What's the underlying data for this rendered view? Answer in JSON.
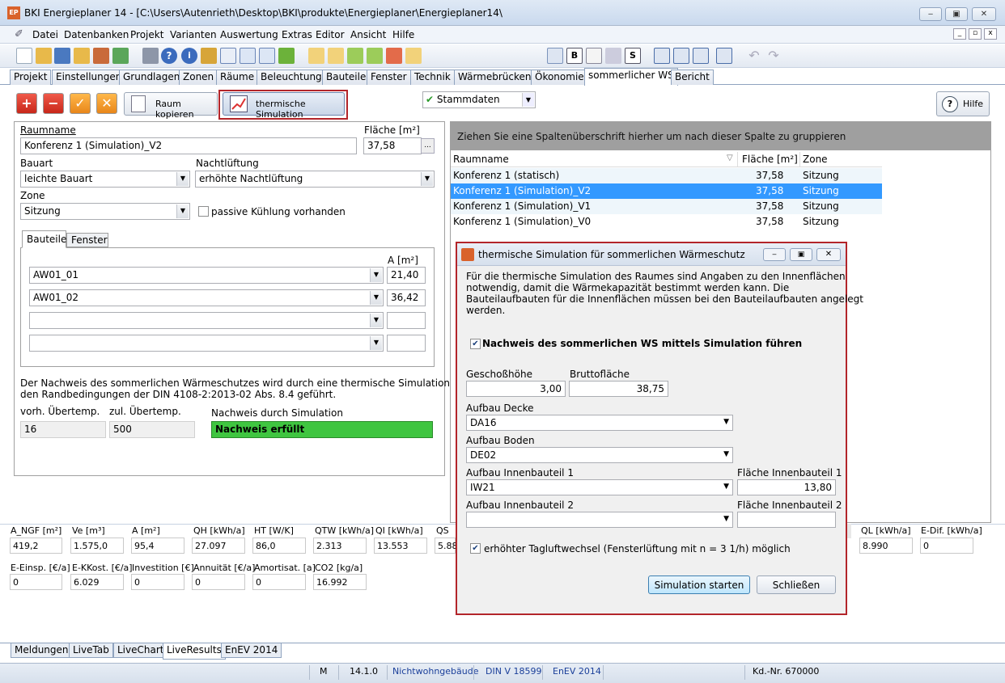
{
  "window": {
    "title": "BKI Energieplaner 14 - [C:\\Users\\Autenrieth\\Desktop\\BKI\\produkte\\Energieplaner\\Energieplaner14\\"
  },
  "menu": [
    "Datei",
    "Datenbanken",
    "Projekt",
    "Varianten",
    "Auswertung",
    "Extras",
    "Editor",
    "Ansicht",
    "Hilfe"
  ],
  "toolbar": {
    "stammdaten": "Stammdaten"
  },
  "tabs": [
    "Projekt",
    "Einstellungen",
    "Grundlagen",
    "Zonen",
    "Räume",
    "Beleuchtung",
    "Bauteile",
    "Fenster",
    "Technik",
    "Wärmebrücken",
    "Ökonomie",
    "sommerlicher WS",
    "Bericht"
  ],
  "actions": {
    "raum_kopieren": "Raum kopieren",
    "thermische_simulation": "thermische Simulation",
    "hilfe": "Hilfe"
  },
  "form": {
    "raumname_label": "Raumname",
    "raumname_value": "Konferenz 1 (Simulation)_V2",
    "flaeche_label": "Fläche [m²]",
    "flaeche_value": "37,58",
    "bauart_label": "Bauart",
    "bauart_value": "leichte Bauart",
    "nachtlueftung_label": "Nachtlüftung",
    "nachtlueftung_value": "erhöhte Nachtlüftung",
    "zone_label": "Zone",
    "zone_value": "Sitzung",
    "passive_kuehlung": "passive Kühlung vorhanden",
    "subtab_bauteile": "Bauteile",
    "subtab_fenster": "Fenster",
    "a_header": "A [m²]",
    "bauteile": [
      {
        "name": "AW01_01",
        "a": "21,40"
      },
      {
        "name": "AW01_02",
        "a": "36,42"
      },
      {
        "name": "",
        "a": ""
      },
      {
        "name": "",
        "a": ""
      }
    ],
    "info_text_1": "Der Nachweis des sommerlichen Wärmeschutzes wird durch eine thermische Simulation mit",
    "info_text_2": "den Randbedingungen der DIN 4108-2:2013-02 Abs. 8.4 geführt.",
    "vorh_label": "vorh. Übertemp.",
    "vorh_value": "16",
    "zul_label": "zul. Übertemp.",
    "zul_value": "500",
    "nachweis_label": "Nachweis durch Simulation",
    "nachweis_value": "Nachweis erfüllt"
  },
  "grid": {
    "group_hint": "Ziehen Sie eine Spaltenüberschrift hierher um nach dieser Spalte zu gruppieren",
    "headers": [
      "Raumname",
      "Fläche [m²]",
      "Zone"
    ],
    "rows": [
      {
        "name": "Konferenz 1 (statisch)",
        "flaeche": "37,58",
        "zone": "Sitzung"
      },
      {
        "name": "Konferenz 1 (Simulation)_V2",
        "flaeche": "37,58",
        "zone": "Sitzung"
      },
      {
        "name": "Konferenz 1 (Simulation)_V1",
        "flaeche": "37,58",
        "zone": "Sitzung"
      },
      {
        "name": "Konferenz 1 (Simulation)_V0",
        "flaeche": "37,58",
        "zone": "Sitzung"
      }
    ]
  },
  "dialog": {
    "title": "thermische Simulation für sommerlichen Wärmeschutz",
    "desc_1": "Für die thermische Simulation des Raumes sind Angaben zu den Innenflächen",
    "desc_2": "notwendig, damit die Wärmekapazität bestimmt werden kann. Die",
    "desc_3": "Bauteilaufbauten für die Innenflächen müssen bei den Bauteilaufbauten angelegt",
    "desc_4": "werden.",
    "check_simulation": "Nachweis des sommerlichen WS mittels Simulation führen",
    "geschoss_label": "Geschoßhöhe",
    "geschoss_value": "3,00",
    "brutto_label": "Bruttofläche",
    "brutto_value": "38,75",
    "decke_label": "Aufbau Decke",
    "decke_value": "DA16",
    "boden_label": "Aufbau Boden",
    "boden_value": "DE02",
    "innen1_label": "Aufbau Innenbauteil 1",
    "innen1_value": "IW21",
    "flaeche1_label": "Fläche Innenbauteil 1",
    "flaeche1_value": "13,80",
    "innen2_label": "Aufbau Innenbauteil 2",
    "innen2_value": "",
    "flaeche2_label": "Fläche Innenbauteil 2",
    "flaeche2_value": "",
    "check_tagluft": "erhöhter Tagluftwechsel (Fensterlüftung mit n = 3 1/h) möglich",
    "btn_start": "Simulation starten",
    "btn_close": "Schließen"
  },
  "live": {
    "row1": [
      {
        "label": "A_NGF [m²]",
        "value": "419,2"
      },
      {
        "label": "Ve [m³]",
        "value": "1.575,0"
      },
      {
        "label": "A [m²]",
        "value": "95,4"
      },
      {
        "label": "QH [kWh/a]",
        "value": "27.097"
      },
      {
        "label": "HT [W/K]",
        "value": "86,0"
      },
      {
        "label": "QTW [kWh/a]",
        "value": "2.313"
      },
      {
        "label": "QI [kWh/a]",
        "value": "13.553"
      },
      {
        "label": "QS",
        "value": "5.88"
      },
      {
        "label": "QL [kWh/a]",
        "value": "8.990"
      },
      {
        "label": "E-Dif. [kWh/a]",
        "value": "0"
      }
    ],
    "row2": [
      {
        "label": "E-Einsp. [€/a]",
        "value": "0"
      },
      {
        "label": "E-KKost. [€/a]",
        "value": "6.029"
      },
      {
        "label": "Investition [€]",
        "value": "0"
      },
      {
        "label": "Annuität [€/a]",
        "value": "0"
      },
      {
        "label": "Amortisat. [a]",
        "value": "0"
      },
      {
        "label": "CO2 [kg/a]",
        "value": "16.992"
      }
    ]
  },
  "bottom_tabs": [
    "Meldungen",
    "LiveTab",
    "LiveChart",
    "LiveResults",
    "EnEV 2014"
  ],
  "status": {
    "mode": "M",
    "version": "14.1.0",
    "type": "Nichtwohngebäude",
    "norm": "DIN V 18599",
    "enev": "EnEV 2014",
    "kdnr": "Kd.-Nr. 670000"
  }
}
